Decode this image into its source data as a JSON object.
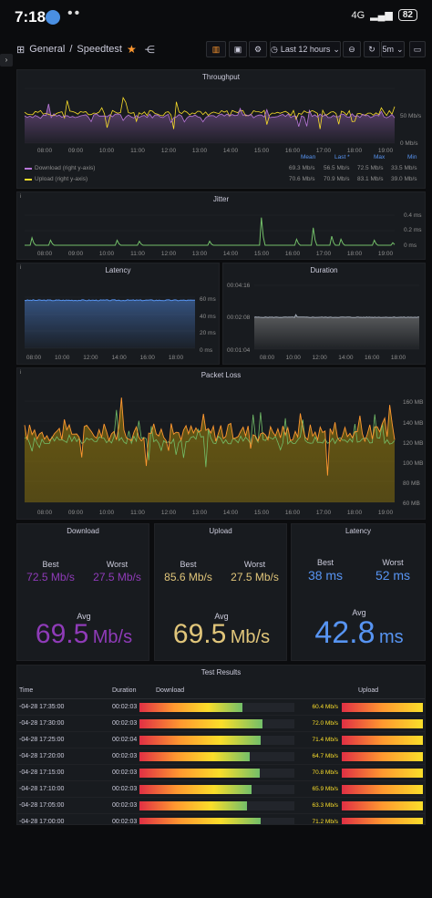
{
  "status": {
    "time": "7:18",
    "signal": "4G",
    "battery": "82"
  },
  "header": {
    "breadcrumb_parent": "General",
    "breadcrumb_sep": "/",
    "breadcrumb_title": "Speedtest",
    "time_range": "Last 12 hours",
    "refresh": "5m"
  },
  "throughput": {
    "title": "Throughput",
    "x_ticks": [
      "08:00",
      "09:00",
      "10:00",
      "11:00",
      "12:00",
      "13:00",
      "14:00",
      "15:00",
      "16:00",
      "17:00",
      "18:00",
      "19:00"
    ],
    "y_ticks": [
      "50 Mb/s",
      "0 Mb/s"
    ],
    "legend_cols": [
      "Mean",
      "Last *",
      "Max",
      "Min"
    ],
    "legend_rows": [
      {
        "name": "Download (right y-axis)",
        "color": "#b877d9",
        "mean": "69.3 Mb/s",
        "last": "56.5 Mb/s",
        "max": "72.5 Mb/s",
        "min": "33.5 Mb/s"
      },
      {
        "name": "Upload (right y-axis)",
        "color": "#fade2a",
        "mean": "70.6 Mb/s",
        "last": "70.9 Mb/s",
        "max": "83.1 Mb/s",
        "min": "39.0 Mb/s"
      }
    ]
  },
  "jitter": {
    "title": "Jitter",
    "x_ticks": [
      "08:00",
      "09:00",
      "10:00",
      "11:00",
      "12:00",
      "13:00",
      "14:00",
      "15:00",
      "16:00",
      "17:00",
      "18:00",
      "19:00"
    ],
    "y_ticks": [
      "0.4 ms",
      "0.2 ms",
      "0 ms"
    ]
  },
  "latency": {
    "title": "Latency",
    "x_ticks": [
      "08:00",
      "10:00",
      "12:00",
      "14:00",
      "16:00",
      "18:00"
    ],
    "y_ticks": [
      "60 ms",
      "40 ms",
      "20 ms",
      "0 ms"
    ]
  },
  "duration": {
    "title": "Duration",
    "x_ticks": [
      "08:00",
      "10:00",
      "12:00",
      "14:00",
      "16:00",
      "18:00"
    ],
    "y_ticks": [
      "00:04:16",
      "00:02:08",
      "00:01:04"
    ]
  },
  "packet_loss": {
    "title": "Packet Loss",
    "x_ticks": [
      "08:00",
      "09:00",
      "10:00",
      "11:00",
      "12:00",
      "13:00",
      "14:00",
      "15:00",
      "16:00",
      "17:00",
      "18:00",
      "19:00"
    ],
    "y_ticks": [
      "160 MB",
      "140 MB",
      "120 MB",
      "100 MB",
      "80 MB",
      "60 MB"
    ]
  },
  "stats": [
    {
      "title": "Download",
      "best_label": "Best",
      "best": "72.5 Mb/s",
      "worst_label": "Worst",
      "worst": "27.5 Mb/s",
      "avg_label": "Avg",
      "avg": "69.5",
      "avg_unit": "Mb/s",
      "color": "#8f3bb8"
    },
    {
      "title": "Upload",
      "best_label": "Best",
      "best": "85.6 Mb/s",
      "worst_label": "Worst",
      "worst": "27.5 Mb/s",
      "avg_label": "Avg",
      "avg": "69.5",
      "avg_unit": "Mb/s",
      "color": "#e0c57a"
    },
    {
      "title": "Latency",
      "best_label": "Best",
      "best": "38 ms",
      "worst_label": "Worst",
      "worst": "52 ms",
      "avg_label": "Avg",
      "avg": "42.8",
      "avg_unit": "ms",
      "color": "#5794f2"
    }
  ],
  "results": {
    "title": "Test Results",
    "columns": [
      "Time",
      "Duration",
      "Download",
      "Upload"
    ],
    "rows": [
      {
        "time": "-04-28 17:35:00",
        "duration": "00:02:03",
        "download": "60.4 Mb/s",
        "dl": 0.604
      },
      {
        "time": "-04-28 17:30:00",
        "duration": "00:02:03",
        "download": "72.0 Mb/s",
        "dl": 0.72
      },
      {
        "time": "-04-28 17:25:00",
        "duration": "00:02:04",
        "download": "71.4 Mb/s",
        "dl": 0.714
      },
      {
        "time": "-04-28 17:20:00",
        "duration": "00:02:03",
        "download": "64.7 Mb/s",
        "dl": 0.647
      },
      {
        "time": "-04-28 17:15:00",
        "duration": "00:02:03",
        "download": "70.8 Mb/s",
        "dl": 0.708
      },
      {
        "time": "-04-28 17:10:00",
        "duration": "00:02:03",
        "download": "65.9 Mb/s",
        "dl": 0.659
      },
      {
        "time": "-04-28 17:05:00",
        "duration": "00:02:03",
        "download": "63.3 Mb/s",
        "dl": 0.633
      },
      {
        "time": "-04-28 17:00:00",
        "duration": "00:02:03",
        "download": "71.2 Mb/s",
        "dl": 0.712
      }
    ]
  }
}
